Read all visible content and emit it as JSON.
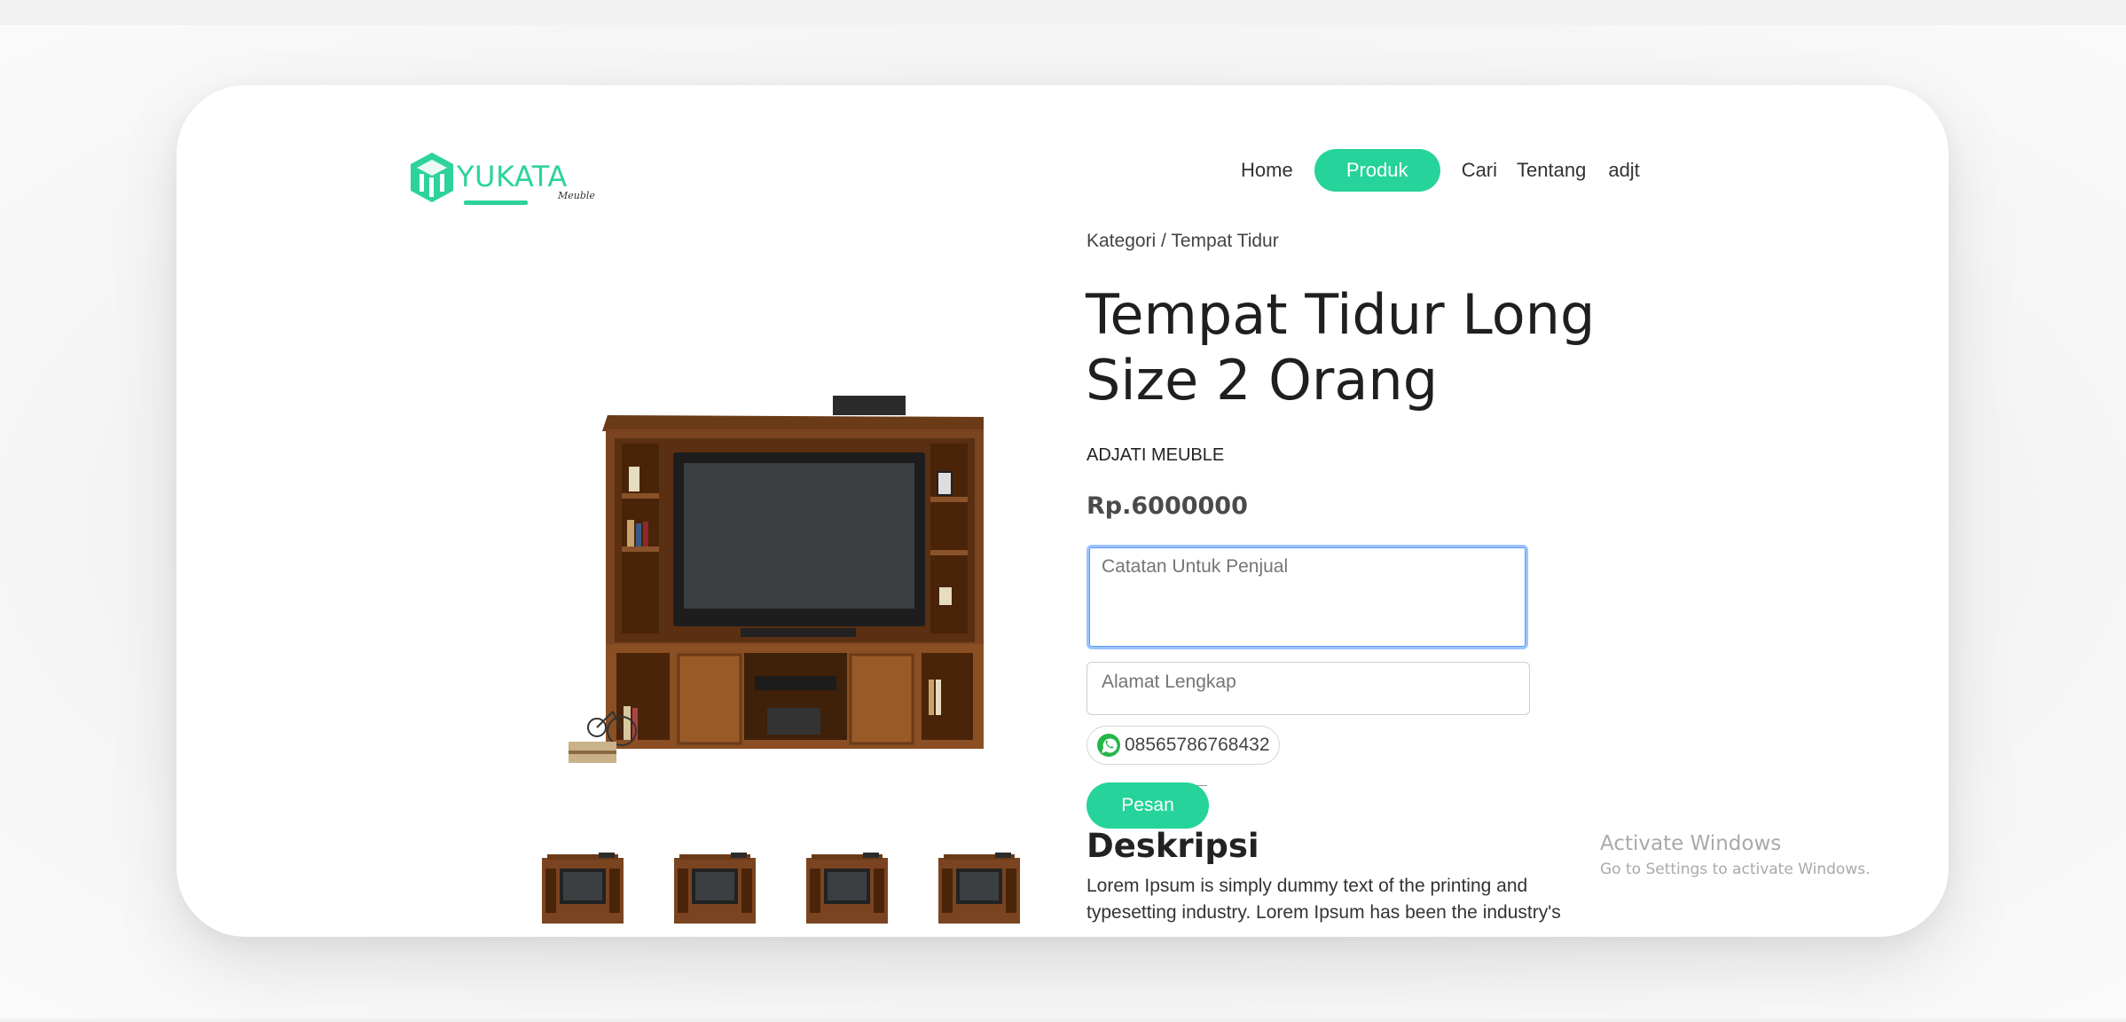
{
  "brand": {
    "name": "YUKATA",
    "tagline": "Meuble",
    "color": "#26d39a",
    "logo_icon": "cube-logo-icon"
  },
  "nav": {
    "items": [
      {
        "label": "Home",
        "active": false
      },
      {
        "label": "Produk",
        "active": true
      },
      {
        "label": "Cari",
        "active": false
      },
      {
        "label": "Tentang",
        "active": false
      },
      {
        "label": "adjt",
        "active": false
      }
    ]
  },
  "product": {
    "breadcrumb": "Kategori / Tempat Tidur",
    "title": "Tempat Tidur Long Size 2 Orang",
    "seller": "ADJATI MEUBLE",
    "price": "Rp.6000000",
    "image_icon": "tv-cabinet-image",
    "thumbnail_count": 4
  },
  "form": {
    "note_placeholder": "Catatan Untuk Penjual",
    "address_placeholder": "Alamat Lengkap",
    "whatsapp_number": "08565786768432",
    "whatsapp_icon": "whatsapp-icon",
    "order_button": "Pesan"
  },
  "description": {
    "heading": "Deskripsi",
    "text": "Lorem Ipsum is simply dummy text of the printing and typesetting industry. Lorem Ipsum has been the industry's"
  },
  "watermark": {
    "title": "Activate Windows",
    "subtitle": "Go to Settings to activate Windows."
  }
}
